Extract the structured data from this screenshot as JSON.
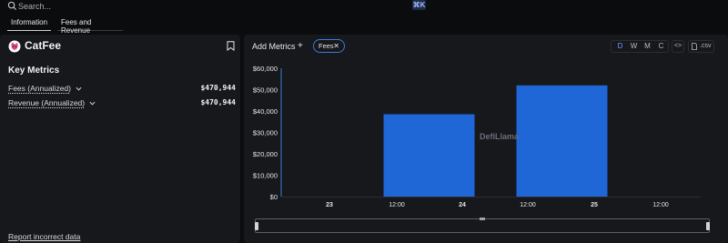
{
  "search": {
    "placeholder": "Search...",
    "shortcut": "⌘K"
  },
  "tabs": [
    {
      "label": "Information",
      "active": true
    },
    {
      "label": "Fees and Revenue",
      "active": false
    }
  ],
  "protocol": {
    "name": "CatFee"
  },
  "key_metrics": {
    "title": "Key Metrics",
    "rows": [
      {
        "label": "Fees (Annualized)",
        "value": "$470,944"
      },
      {
        "label": "Revenue (Annualized)",
        "value": "$470,944"
      }
    ]
  },
  "report_link": "Report incorrect data",
  "toolbar": {
    "add_metrics": "Add Metrics",
    "plus": "+",
    "chip_label": "Fees",
    "chip_close": "✕",
    "granularity": [
      "D",
      "W",
      "M",
      "C"
    ],
    "granularity_active": "D",
    "embed": "<>",
    "csv": ".csv"
  },
  "colors": {
    "accent": "#1f66d6",
    "chip_border": "#3b7bd9",
    "panel": "#16181c",
    "background": "#0b0c0e"
  },
  "watermark": "DefiLlama",
  "chart_data": {
    "type": "bar",
    "series": [
      {
        "values": [
          {
            "x": "24 00:00",
            "y": 38500
          },
          {
            "x": "25 00:00",
            "y": 52000
          }
        ]
      }
    ],
    "x_ticks": [
      "23",
      "12:00",
      "24",
      "12:00",
      "25",
      "12:00"
    ],
    "y_ticks": [
      "$0",
      "$10,000",
      "$20,000",
      "$30,000",
      "$40,000",
      "$50,000",
      "$60,000"
    ],
    "ylim": [
      0,
      60000
    ],
    "grid": false
  }
}
